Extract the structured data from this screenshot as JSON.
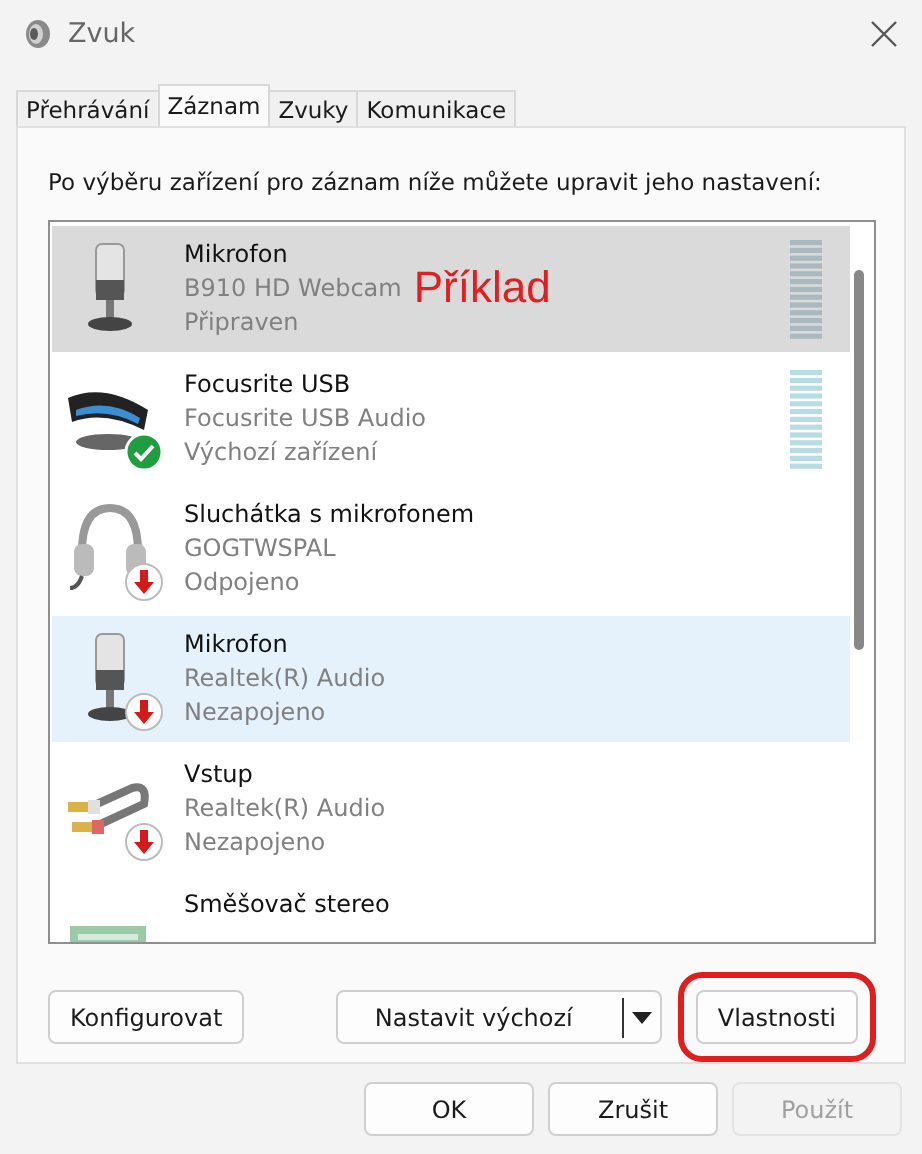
{
  "window": {
    "title": "Zvuk"
  },
  "tabs": [
    {
      "label": "Přehrávání",
      "selected": false
    },
    {
      "label": "Záznam",
      "selected": true
    },
    {
      "label": "Zvuky",
      "selected": false
    },
    {
      "label": "Komunikace",
      "selected": false
    }
  ],
  "instruction": "Po výběru zařízení pro záznam níže můžete upravit jeho nastavení:",
  "devices": [
    {
      "kind": "mic",
      "name": "Mikrofon",
      "detail": "B910 HD Webcam",
      "status": "Připraven",
      "is_default": false,
      "unplugged": false,
      "selected": true,
      "hovered": false,
      "meter": true,
      "annotation": "Příklad"
    },
    {
      "kind": "interface",
      "name": "Focusrite USB",
      "detail": "Focusrite USB Audio",
      "status": "Výchozí zařízení",
      "is_default": true,
      "unplugged": false,
      "selected": false,
      "hovered": false,
      "meter": true
    },
    {
      "kind": "headset",
      "name": "Sluchátka s mikrofonem",
      "detail": "GOGTWSPAL",
      "status": "Odpojeno",
      "is_default": false,
      "unplugged": true,
      "selected": false,
      "hovered": false,
      "meter": false
    },
    {
      "kind": "mic",
      "name": "Mikrofon",
      "detail": "Realtek(R) Audio",
      "status": "Nezapojeno",
      "is_default": false,
      "unplugged": true,
      "selected": false,
      "hovered": true,
      "meter": false
    },
    {
      "kind": "linein",
      "name": "Vstup",
      "detail": "Realtek(R) Audio",
      "status": "Nezapojeno",
      "is_default": false,
      "unplugged": true,
      "selected": false,
      "hovered": false,
      "meter": false
    },
    {
      "kind": "mixer",
      "name": "Směšovač stereo",
      "selected": false,
      "hovered": false,
      "meter": false
    }
  ],
  "panel_buttons": [
    {
      "kind": "plain",
      "label": "Konfigurovat",
      "highlighted": false
    },
    {
      "kind": "split",
      "label": "Nastavit výchozí",
      "highlighted": false
    },
    {
      "kind": "plain",
      "label": "Vlastnosti",
      "highlighted": true
    }
  ],
  "dialog_buttons": [
    {
      "label": "OK",
      "disabled": false
    },
    {
      "label": "Zrušit",
      "disabled": false
    },
    {
      "label": "Použít",
      "disabled": true
    }
  ]
}
